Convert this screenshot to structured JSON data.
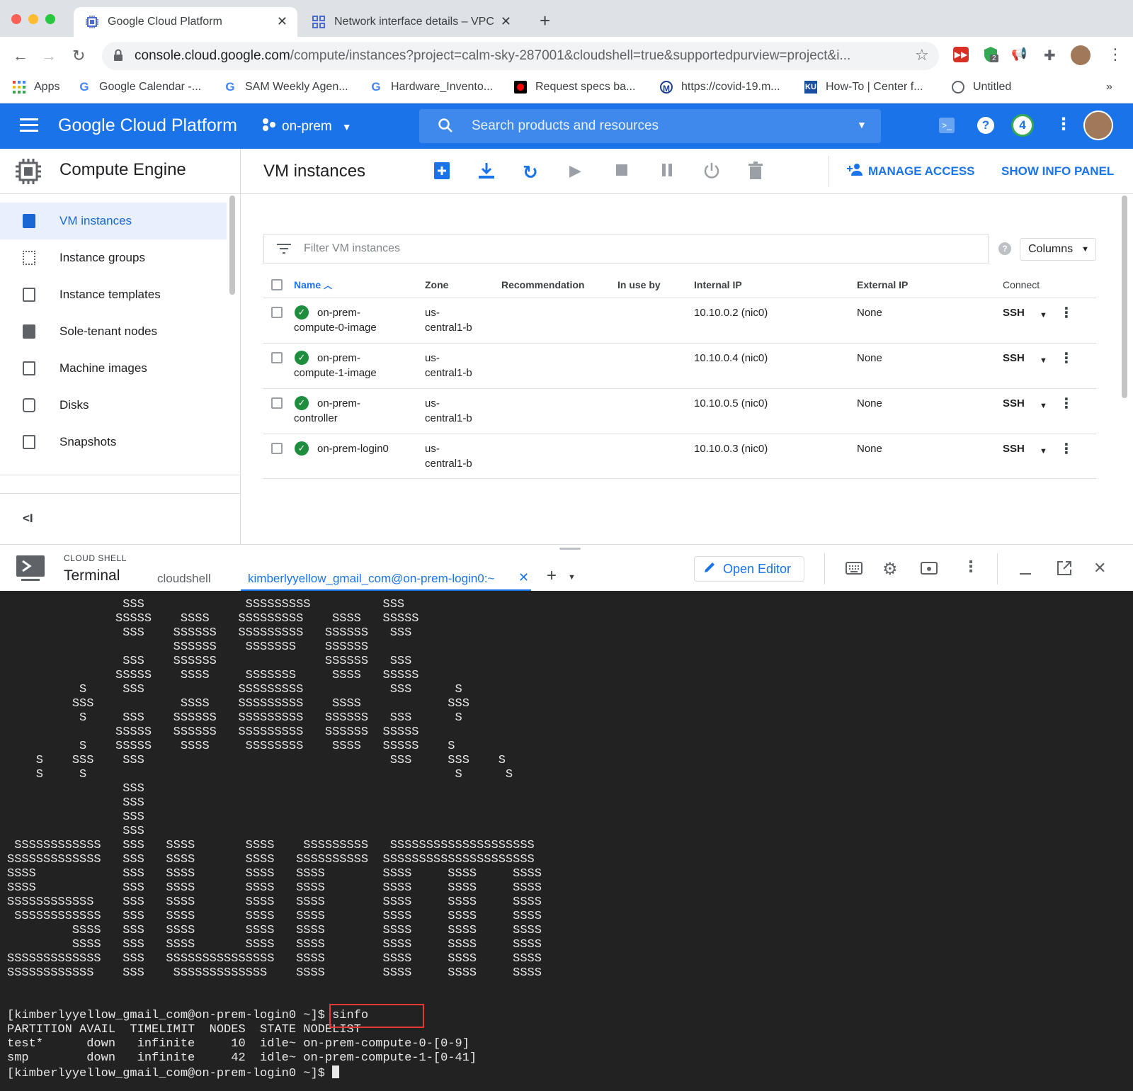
{
  "browser": {
    "tabs": [
      {
        "title": "Google Cloud Platform",
        "active": true
      },
      {
        "title": "Network interface details – VPC",
        "active": false
      }
    ],
    "new_tab_label": "+",
    "url_host": "console.cloud.google.com",
    "url_path": "/compute/instances?project=calm-sky-287001&cloudshell=true&supportedpurview=project&i...",
    "bookmarks": [
      {
        "label": "Apps",
        "icon": "apps-grid-icon"
      },
      {
        "label": "Google Calendar -...",
        "icon": "google-icon"
      },
      {
        "label": "SAM Weekly Agen...",
        "icon": "google-icon"
      },
      {
        "label": "Hardware_Invento...",
        "icon": "google-icon"
      },
      {
        "label": "Request specs ba...",
        "icon": "record-icon"
      },
      {
        "label": "https://covid-19.m...",
        "icon": "m-logo-icon"
      },
      {
        "label": "How-To | Center f...",
        "icon": "ku-logo-icon"
      },
      {
        "label": "Untitled",
        "icon": "seal-icon"
      }
    ],
    "bookmarks_more": "»",
    "extension_badge": "2"
  },
  "gcp": {
    "product_title": "Google Cloud Platform",
    "project": "on-prem",
    "search_placeholder": "Search products and resources",
    "notification_count": "4",
    "colors": {
      "header": "#1a73e8",
      "active_nav_bg": "#e8f0fe",
      "link": "#1a73e8",
      "status_ok": "#1e8e3e"
    }
  },
  "sidebar": {
    "section_title": "Compute Engine",
    "items": [
      {
        "label": "VM instances",
        "active": true
      },
      {
        "label": "Instance groups"
      },
      {
        "label": "Instance templates"
      },
      {
        "label": "Sole-tenant nodes"
      },
      {
        "label": "Machine images"
      },
      {
        "label": "Disks"
      },
      {
        "label": "Snapshots"
      }
    ],
    "collapse_label": "<I"
  },
  "main": {
    "page_title": "VM instances",
    "manage_access": "MANAGE ACCESS",
    "show_info_panel": "SHOW INFO PANEL",
    "filter_placeholder": "Filter VM instances",
    "columns_button": "Columns",
    "headers": {
      "name": "Name",
      "zone": "Zone",
      "recommendation": "Recommendation",
      "in_use_by": "In use by",
      "internal_ip": "Internal IP",
      "external_ip": "External IP",
      "connect": "Connect"
    },
    "rows": [
      {
        "name_1": "on-prem-",
        "name_2": "compute-0-image",
        "zone_1": "us-",
        "zone_2": "central1-b",
        "internal_ip": "10.10.0.2 (nic0)",
        "external_ip": "None",
        "connect": "SSH"
      },
      {
        "name_1": "on-prem-",
        "name_2": "compute-1-image",
        "zone_1": "us-",
        "zone_2": "central1-b",
        "internal_ip": "10.10.0.4 (nic0)",
        "external_ip": "None",
        "connect": "SSH"
      },
      {
        "name_1": "on-prem-",
        "name_2": "controller",
        "zone_1": "us-",
        "zone_2": "central1-b",
        "internal_ip": "10.10.0.5 (nic0)",
        "external_ip": "None",
        "connect": "SSH"
      },
      {
        "name_1": "on-prem-login0",
        "name_2": "",
        "zone_1": "us-",
        "zone_2": "central1-b",
        "internal_ip": "10.10.0.3 (nic0)",
        "external_ip": "None",
        "connect": "SSH"
      }
    ]
  },
  "cloudshell": {
    "label": "CLOUD SHELL",
    "title": "Terminal",
    "tabs": [
      {
        "label": "cloudshell",
        "active": false
      },
      {
        "label": "kimberlyyellow_gmail_com@on-prem-login0:~",
        "active": true
      }
    ],
    "add_tab": "+",
    "open_editor": "Open Editor"
  },
  "terminal": {
    "banner": [
      "                SSS              SSSSSSSSS          SSS",
      "               SSSSS    SSSS    SSSSSSSSS    SSSS   SSSSS",
      "                SSS    SSSSSS   SSSSSSSSS   SSSSSS   SSS",
      "                       SSSSSS    SSSSSSS    SSSSSS",
      "                SSS    SSSSSS               SSSSSS   SSS",
      "               SSSSS    SSSS     SSSSSSS     SSSS   SSSSS",
      "          S     SSS             SSSSSSSSS            SSS      S",
      "         SSS            SSSS    SSSSSSSSS    SSSS            SSS",
      "          S     SSS    SSSSSS   SSSSSSSSS   SSSSSS   SSS      S",
      "               SSSSS   SSSSSS   SSSSSSSSS   SSSSSS  SSSSS",
      "          S    SSSSS    SSSS     SSSSSSSS    SSSS   SSSSS    S",
      "    S    SSS    SSS                                  SSS     SSS    S",
      "    S     S                                                   S      S",
      "                SSS",
      "                SSS",
      "                SSS",
      "                SSS",
      " SSSSSSSSSSSS   SSS   SSSS       SSSS    SSSSSSSSS   SSSSSSSSSSSSSSSSSSSS",
      "SSSSSSSSSSSSS   SSS   SSSS       SSSS   SSSSSSSSSS  SSSSSSSSSSSSSSSSSSSSS",
      "SSSS            SSS   SSSS       SSSS   SSSS        SSSS     SSSS     SSSS",
      "SSSS            SSS   SSSS       SSSS   SSSS        SSSS     SSSS     SSSS",
      "SSSSSSSSSSSS    SSS   SSSS       SSSS   SSSS        SSSS     SSSS     SSSS",
      " SSSSSSSSSSSS   SSS   SSSS       SSSS   SSSS        SSSS     SSSS     SSSS",
      "         SSSS   SSS   SSSS       SSSS   SSSS        SSSS     SSSS     SSSS",
      "         SSSS   SSS   SSSS       SSSS   SSSS        SSSS     SSSS     SSSS",
      "SSSSSSSSSSSSS   SSS   SSSSSSSSSSSSSSS   SSSS        SSSS     SSSS     SSSS",
      "SSSSSSSSSSSS    SSS    SSSSSSSSSSSSS    SSSS        SSSS     SSSS     SSSS",
      "",
      ""
    ],
    "prompt1": "[kimberlyyellow_gmail_com@on-prem-login0 ~]$ sinfo",
    "output": [
      "PARTITION AVAIL  TIMELIMIT  NODES  STATE NODELIST",
      "test*      down   infinite     10  idle~ on-prem-compute-0-[0-9]",
      "smp        down   infinite     42  idle~ on-prem-compute-1-[0-41]"
    ],
    "prompt2": "[kimberlyyellow_gmail_com@on-prem-login0 ~]$ "
  }
}
